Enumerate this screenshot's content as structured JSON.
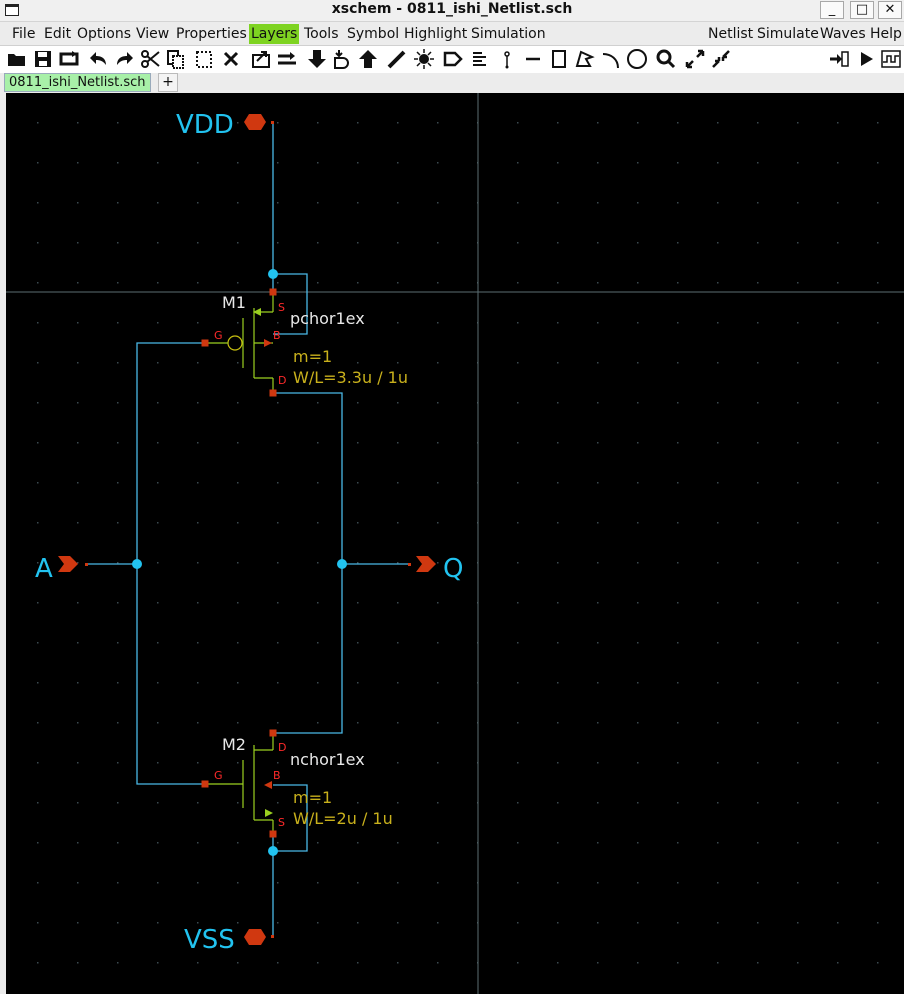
{
  "window": {
    "title": "xschem - 0811_ishi_Netlist.sch",
    "buttons": [
      "_",
      "□",
      "✕"
    ]
  },
  "menu": {
    "items": [
      "File",
      "Edit",
      "Options",
      "View",
      "Properties",
      "Layers",
      "Tools",
      "Symbol",
      "Highlight",
      "Simulation"
    ],
    "right_items": [
      "Netlist",
      "Simulate",
      "Waves",
      "Help"
    ],
    "active": "Layers"
  },
  "toolbar": {
    "icons": [
      "open-icon",
      "save-icon",
      "reload-icon",
      "undo-icon",
      "redo-icon",
      "cut-icon",
      "copy-icon",
      "paste-icon",
      "delete-icon",
      "move-icon",
      "swap-icon",
      "down-icon",
      "insert-symbol-icon",
      "up-icon",
      "draw-wire-icon",
      "highlight-icon",
      "pin-icon",
      "text-icon",
      "probe-icon",
      "line-icon",
      "rect-icon",
      "polygon-icon",
      "arc-icon",
      "circle-icon",
      "zoom-icon",
      "zoom-full-icon",
      "zoom-fit-icon",
      "netlist-icon",
      "simulate-icon",
      "waves-icon"
    ]
  },
  "tabs": {
    "active_label": "0811_ishi_Netlist.sch",
    "add_label": "+"
  },
  "colors": {
    "wire": "#4ab8e6",
    "pin_label": "#22c3f0",
    "port": "#d03810",
    "instance_name": "#e8e8e8",
    "param": "#c8b01c",
    "pin_letter": "#ff2a2a",
    "transistor_body": "#9bd020",
    "grid_dot": "#3b4a50",
    "crosshair": "#5b6e72"
  },
  "schematic": {
    "ports": {
      "vdd": "VDD",
      "vss": "VSS",
      "in": "A",
      "out": "Q"
    },
    "m1": {
      "name": "M1",
      "model": "pchor1ex",
      "mult": "m=1",
      "wl": "W/L=3.3u / 1u",
      "pins": {
        "s": "S",
        "b": "B",
        "g": "G",
        "d": "D"
      }
    },
    "m2": {
      "name": "M2",
      "model": "nchor1ex",
      "mult": "m=1",
      "wl": "W/L=2u / 1u",
      "pins": {
        "d": "D",
        "b": "B",
        "g": "G",
        "s": "S"
      }
    }
  }
}
